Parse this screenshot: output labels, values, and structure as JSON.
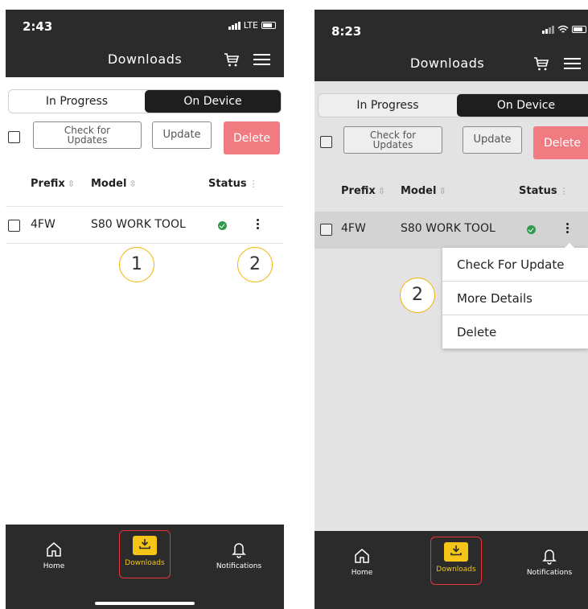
{
  "left": {
    "status": {
      "time": "2:43",
      "network": "LTE"
    },
    "header": {
      "title": "Downloads"
    },
    "tabs": [
      "In Progress",
      "On Device"
    ],
    "actions": {
      "check_updates": "Check for Updates",
      "update": "Update",
      "delete": "Delete"
    },
    "columns": [
      "Prefix",
      "Model",
      "Status"
    ],
    "row": {
      "prefix": "4FW",
      "model": "S80 WORK TOOL"
    },
    "callouts": [
      "1",
      "2"
    ],
    "nav": {
      "home": "Home",
      "downloads": "Downloads",
      "notifications": "Notifications"
    }
  },
  "right": {
    "status": {
      "time": "8:23"
    },
    "header": {
      "title": "Downloads"
    },
    "tabs": [
      "In Progress",
      "On Device"
    ],
    "actions": {
      "check_updates": "Check for Updates",
      "update": "Update",
      "delete": "Delete"
    },
    "columns": [
      "Prefix",
      "Model",
      "Status"
    ],
    "row": {
      "prefix": "4FW",
      "model": "S80 WORK TOOL"
    },
    "menu": [
      "Check For Update",
      "More Details",
      "Delete"
    ],
    "callouts": [
      "2"
    ],
    "nav": {
      "home": "Home",
      "downloads": "Downloads",
      "notifications": "Notifications"
    }
  },
  "colors": {
    "header_bg": "#2b2b2b",
    "accent": "#f5c518",
    "delete": "#f07b80",
    "status_ok": "#2e9b4b",
    "highlight": "#e8333a"
  },
  "icons": [
    "cart-icon",
    "menu-icon",
    "home-icon",
    "download-icon",
    "bell-icon",
    "check-circle-icon",
    "kebab-icon",
    "sort-icon"
  ]
}
